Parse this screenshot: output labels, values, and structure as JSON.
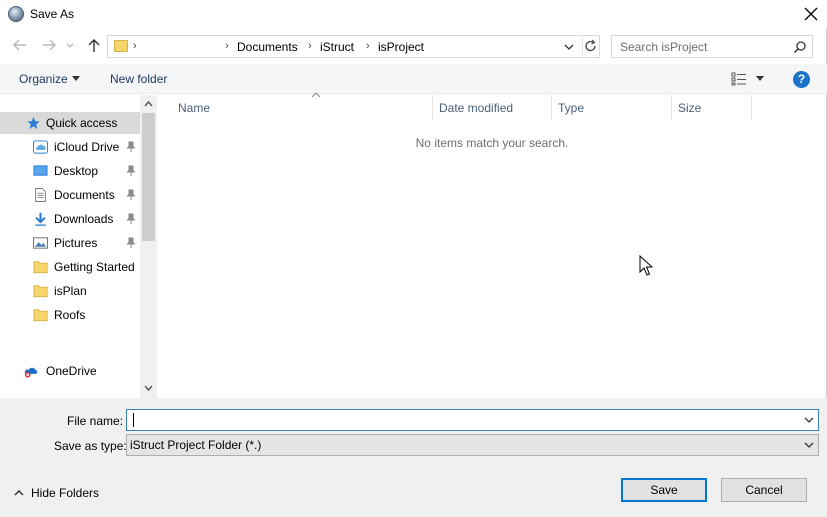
{
  "window": {
    "title": "Save As"
  },
  "address": {
    "segments": [
      "Documents",
      "iStruct",
      "isProject"
    ],
    "chevron": "›"
  },
  "search": {
    "placeholder": "Search isProject"
  },
  "toolbar": {
    "organize": "Organize",
    "new_folder": "New folder",
    "help": "?"
  },
  "nav": {
    "items": [
      {
        "label": "Quick access",
        "icon": "star-icon",
        "pinned": false
      },
      {
        "label": "iCloud Drive",
        "icon": "icloud-icon",
        "pinned": true
      },
      {
        "label": "Desktop",
        "icon": "desktop-icon",
        "pinned": true
      },
      {
        "label": "Documents",
        "icon": "documents-icon",
        "pinned": true
      },
      {
        "label": "Downloads",
        "icon": "downloads-icon",
        "pinned": true
      },
      {
        "label": "Pictures",
        "icon": "pictures-icon",
        "pinned": true
      },
      {
        "label": "Getting Started",
        "icon": "folder-icon",
        "pinned": false
      },
      {
        "label": "isPlan",
        "icon": "folder-icon",
        "pinned": false
      },
      {
        "label": "Roofs",
        "icon": "folder-icon",
        "pinned": false
      },
      {
        "label": "OneDrive",
        "icon": "onedrive-icon",
        "pinned": false
      }
    ]
  },
  "filelist": {
    "columns": [
      "Name",
      "Date modified",
      "Type",
      "Size"
    ],
    "empty_message": "No items match your search."
  },
  "form": {
    "file_name_label": "File name:",
    "file_name_value": "",
    "save_type_label": "Save as type:",
    "save_type_value": "iStruct Project Folder (*.)"
  },
  "footer": {
    "hide_folders": "Hide Folders",
    "save": "Save",
    "cancel": "Cancel"
  },
  "colors": {
    "accent": "#0078d7",
    "link": "#1e3960",
    "selection": "#cce8ff",
    "folder": "#f7d56d"
  }
}
